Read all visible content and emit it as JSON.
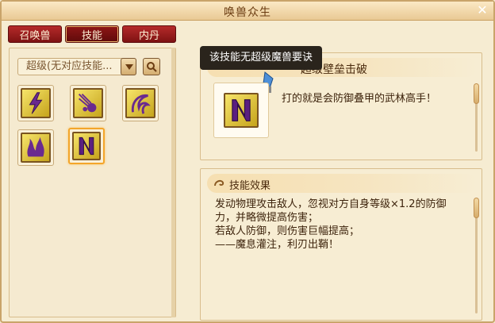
{
  "window": {
    "title": "唤兽众生",
    "close_icon": "close-icon"
  },
  "tabs": [
    {
      "label": "召唤兽",
      "active": false
    },
    {
      "label": "技能",
      "active": true
    },
    {
      "label": "内丹",
      "active": false
    }
  ],
  "filter": {
    "value": "超级(无对应技能..."
  },
  "skills": [
    {
      "icon": "lightning-skill-icon",
      "selected": false
    },
    {
      "icon": "meteor-skill-icon",
      "selected": false
    },
    {
      "icon": "whirl-skill-icon",
      "selected": false
    },
    {
      "icon": "flame-skill-icon",
      "selected": false
    },
    {
      "icon": "rampart-skill-icon",
      "selected": true
    }
  ],
  "tooltip": "该技能无超级魔兽要诀",
  "detail": {
    "skill_name": "超级壁垒击破",
    "description": "打的就是会防御叠甲的武林高手！"
  },
  "effect": {
    "heading": "技能效果",
    "lines": [
      "发动物理攻击敌人，忽视对方自身等级×1.2的防御",
      "力，并略微提高伤害；",
      "若敌人防御，则伤害巨幅提高；",
      "——魔息灌注，利刃出鞘！"
    ]
  },
  "colors": {
    "tab_red": "#9b1d1d",
    "gold": "#e8c33a",
    "tooltip_bg": "#2a241c"
  }
}
